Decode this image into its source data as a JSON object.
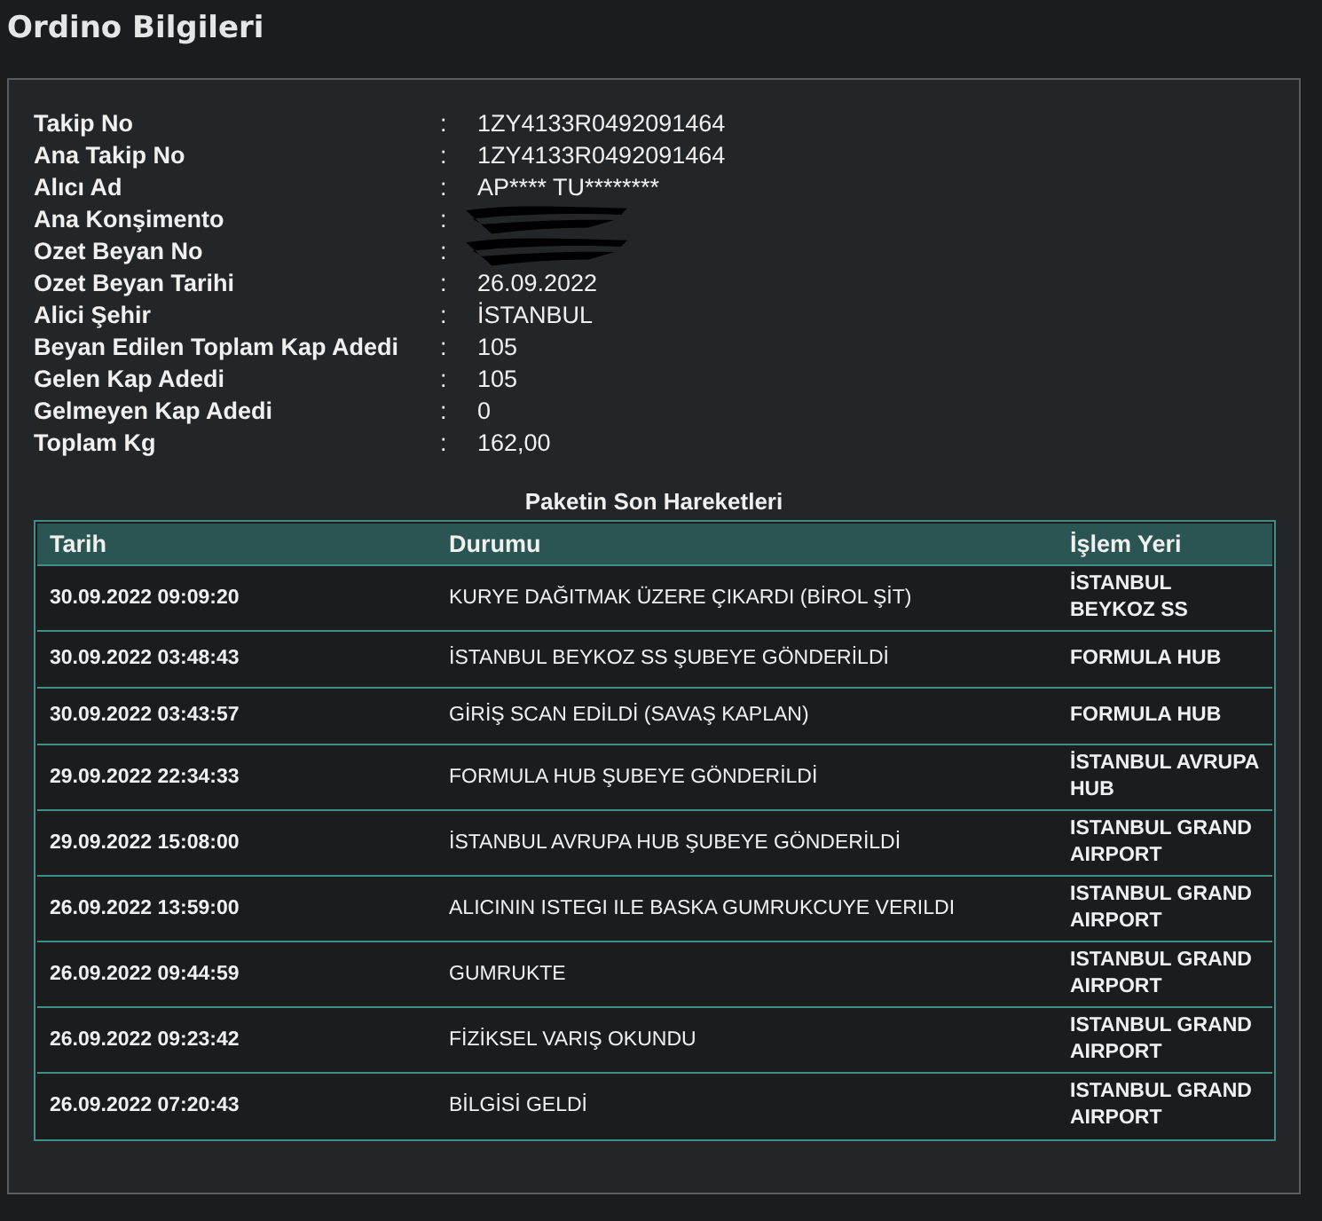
{
  "title": "Ordino Bilgileri",
  "fields": [
    {
      "label": "Takip No",
      "separator": ":",
      "value": "1ZY4133R0492091464"
    },
    {
      "label": "Ana Takip No",
      "separator": ":",
      "value": "1ZY4133R0492091464"
    },
    {
      "label": "Alıcı Ad",
      "separator": ":",
      "value": "AP**** TU********"
    },
    {
      "label": "Ana Konşimento",
      "separator": ":",
      "redacted": true
    },
    {
      "label": "Ozet Beyan No",
      "separator": ":",
      "redacted": true
    },
    {
      "label": "Ozet Beyan Tarihi",
      "separator": ":",
      "value": "26.09.2022"
    },
    {
      "label": "Alici Şehir",
      "separator": ":",
      "value": "İSTANBUL"
    },
    {
      "label": "Beyan Edilen Toplam Kap Adedi",
      "separator": ":",
      "value": "105"
    },
    {
      "label": "Gelen Kap Adedi",
      "separator": ":",
      "value": "105"
    },
    {
      "label": "Gelmeyen Kap Adedi",
      "separator": ":",
      "value": "0"
    },
    {
      "label": "Toplam Kg",
      "separator": ":",
      "value": "162,00"
    }
  ],
  "movements": {
    "caption": "Paketin Son Hareketleri",
    "columns": [
      "Tarih",
      "Durumu",
      "İşlem Yeri"
    ],
    "rows": [
      [
        "30.09.2022 09:09:20",
        "KURYE DAĞITMAK ÜZERE ÇIKARDI (BİROL ŞİT)",
        "İSTANBUL BEYKOZ SS"
      ],
      [
        "30.09.2022 03:48:43",
        "İSTANBUL BEYKOZ SS ŞUBEYE GÖNDERİLDİ",
        "FORMULA HUB"
      ],
      [
        "30.09.2022 03:43:57",
        "GİRİŞ SCAN EDİLDİ (SAVAŞ KAPLAN)",
        "FORMULA HUB"
      ],
      [
        "29.09.2022 22:34:33",
        "FORMULA HUB ŞUBEYE GÖNDERİLDİ",
        "İSTANBUL AVRUPA HUB"
      ],
      [
        "29.09.2022 15:08:00",
        "İSTANBUL AVRUPA HUB ŞUBEYE GÖNDERİLDİ",
        "ISTANBUL GRAND AIRPORT"
      ],
      [
        "26.09.2022 13:59:00",
        "ALICININ ISTEGI ILE BASKA GUMRUKCUYE VERILDI",
        "ISTANBUL GRAND AIRPORT"
      ],
      [
        "26.09.2022 09:44:59",
        "GUMRUKTE",
        "ISTANBUL GRAND AIRPORT"
      ],
      [
        "26.09.2022 09:23:42",
        "FİZİKSEL VARIŞ OKUNDU",
        "ISTANBUL GRAND AIRPORT"
      ],
      [
        "26.09.2022 07:20:43",
        "BİLGİSİ GELDİ",
        "ISTANBUL GRAND AIRPORT"
      ]
    ]
  }
}
